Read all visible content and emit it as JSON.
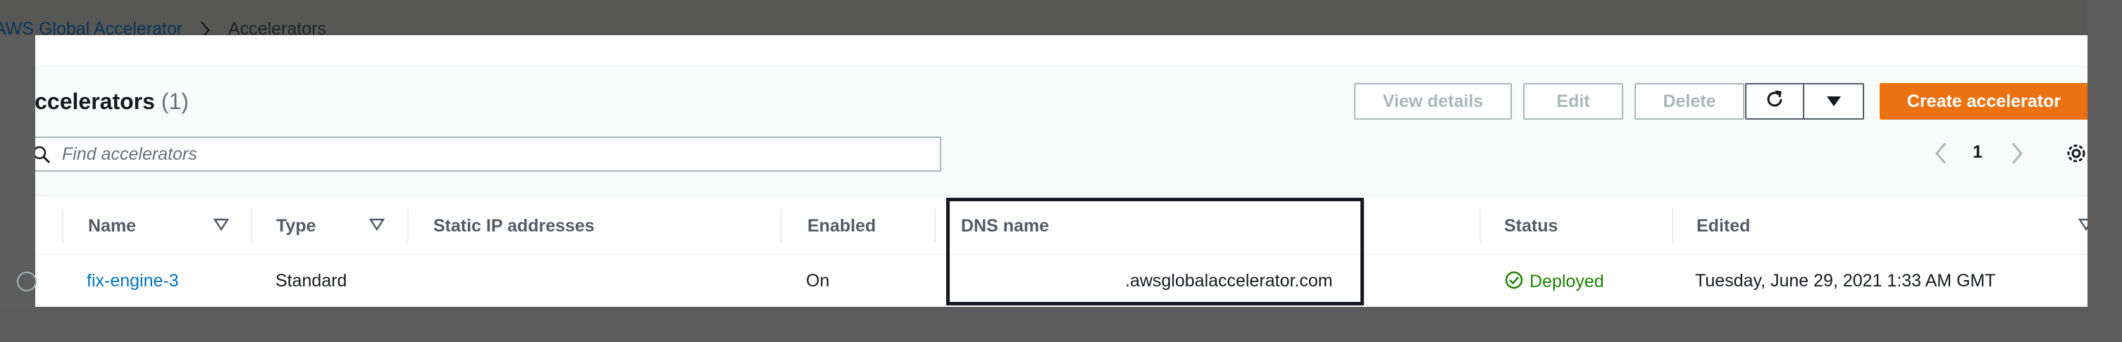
{
  "breadcrumb": {
    "root": "AWS Global Accelerator",
    "current": "Accelerators"
  },
  "header": {
    "title": "Accelerators",
    "count": "(1)"
  },
  "toolbar": {
    "view_details": "View details",
    "edit": "Edit",
    "delete": "Delete",
    "create": "Create accelerator"
  },
  "search": {
    "placeholder": "Find accelerators"
  },
  "pagination": {
    "current_page": "1"
  },
  "table": {
    "columns": [
      "Name",
      "Type",
      "Static IP addresses",
      "Enabled",
      "DNS name",
      "Status",
      "Edited"
    ],
    "rows": [
      {
        "name": "fix-engine-3",
        "type": "Standard",
        "static_ips": "",
        "enabled": "On",
        "dns_name": ".awsglobalaccelerator.com",
        "status": "Deployed",
        "edited": "Tuesday, June 29, 2021 1:33 AM GMT"
      }
    ]
  },
  "colors": {
    "accent_orange": "#ec7211",
    "link_blue": "#0073bb",
    "status_green": "#1d8102",
    "overlay_gray": "#5b5c5b"
  },
  "icons": {
    "search": "search-icon",
    "refresh": "refresh-icon",
    "caret": "caret-down-icon",
    "prev": "chevron-left-icon",
    "next": "chevron-right-icon",
    "settings": "gear-icon",
    "status": "check-circle-icon",
    "sort": "sort-down-icon"
  }
}
